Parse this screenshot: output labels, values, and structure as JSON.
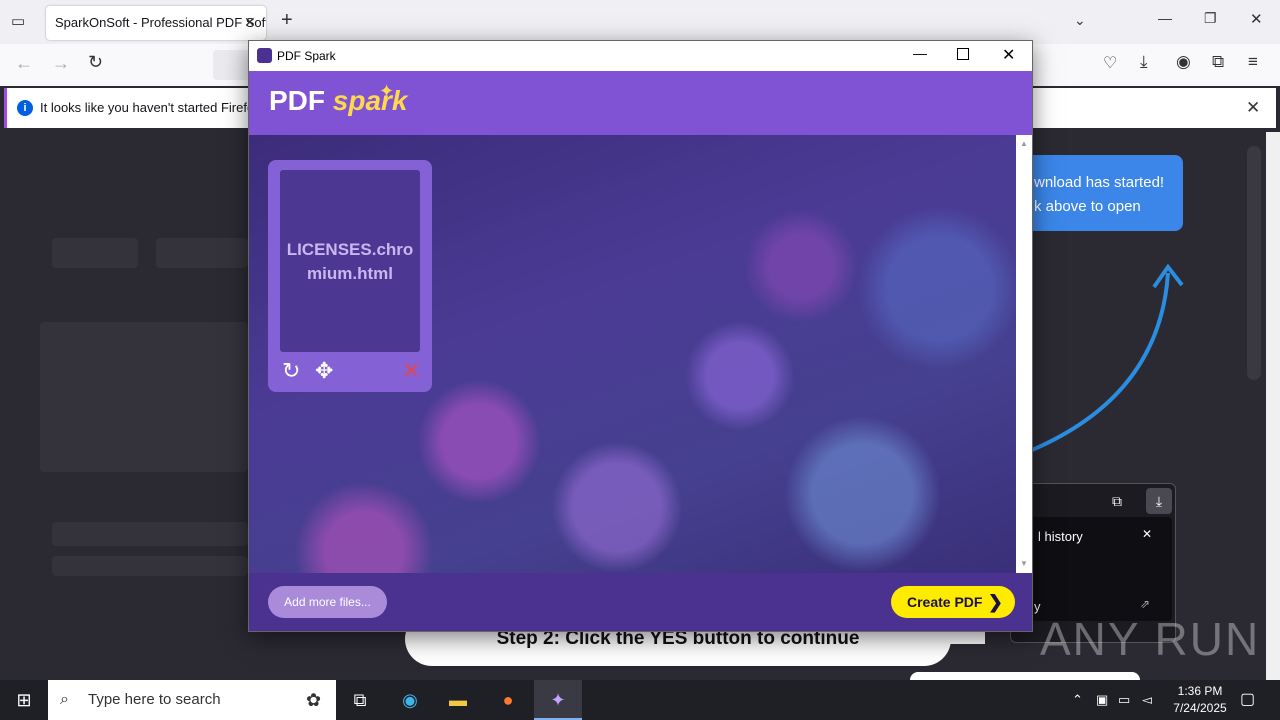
{
  "browser": {
    "tab_title": "SparkOnSoft - Professional PDF Soft",
    "notification": "It looks like you haven't started Firefox"
  },
  "page_behind": {
    "bubble_line1": "wnload has started!",
    "bubble_line2": "k above to open",
    "panel_text": "l history",
    "panel_text2": "y",
    "step_banner": "Step 2: Click the YES button to continue",
    "watermark": "ANY RUN"
  },
  "app": {
    "window_title": "PDF Spark",
    "logo_text_pdf": "PDF",
    "logo_text_spark": "spark",
    "file_name": "LICENSES.chromium.html",
    "add_button": "Add more files...",
    "create_button": "Create PDF",
    "accent": "#7f53d3",
    "create_color": "#ffeb00"
  },
  "taskbar": {
    "search_placeholder": "Type here to search",
    "time": "1:36 PM",
    "date": "7/24/2025"
  }
}
